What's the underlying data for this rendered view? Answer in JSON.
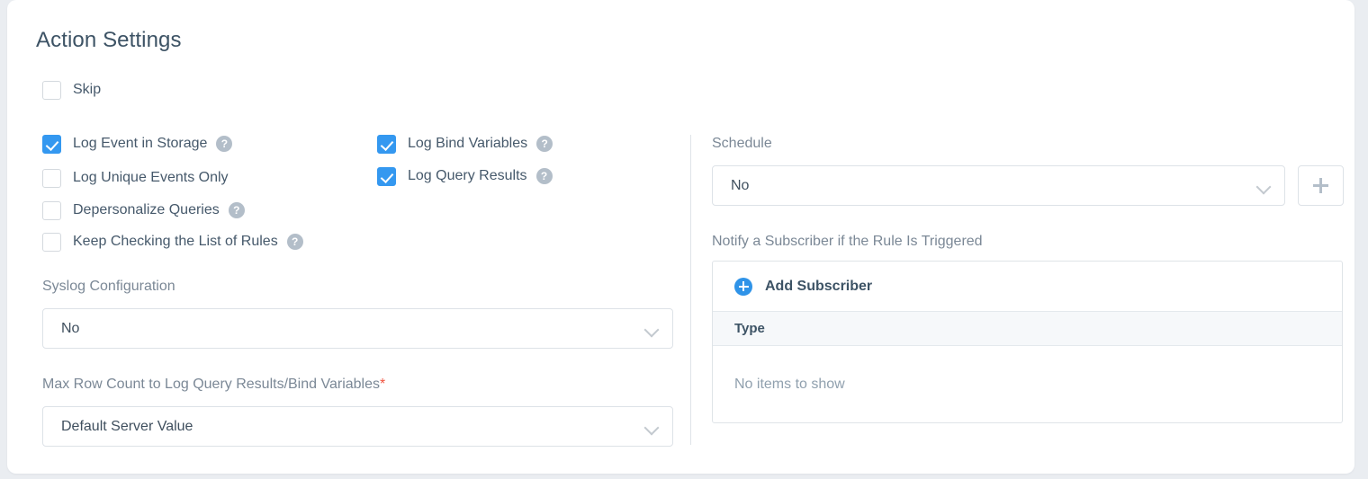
{
  "page": {
    "title": "Action Settings"
  },
  "colors": {
    "accent": "#3498f0",
    "accent_add": "#2f93e8",
    "help_icon": "#b3bec9",
    "required_marker": "#f0533f",
    "heading_text": "#3d5365",
    "label_text": "#7b8896",
    "card_background": "#ffffff",
    "page_background": "#eaedf1",
    "table_header_background": "#f6f8fa",
    "border": "#dfe4e8"
  },
  "skip": {
    "label": "Skip",
    "checked": false
  },
  "checkbox_column_left": [
    {
      "label": "Log Event in Storage",
      "checked": true,
      "help": true,
      "help_glyph": "?"
    },
    {
      "label": "Log Unique Events Only",
      "checked": false,
      "help": false,
      "help_glyph": "?"
    },
    {
      "label": "Depersonalize Queries",
      "checked": false,
      "help": true,
      "help_glyph": "?"
    },
    {
      "label": "Keep Checking the List of Rules",
      "checked": false,
      "help": true,
      "help_glyph": "?"
    }
  ],
  "checkbox_column_right": [
    {
      "label": "Log Bind Variables",
      "checked": true,
      "help": true,
      "help_glyph": "?"
    },
    {
      "label": "Log Query Results",
      "checked": true,
      "help": true,
      "help_glyph": "?"
    }
  ],
  "syslog": {
    "label": "Syslog Configuration",
    "value": "No",
    "chevron_icon": "chevron-down-icon"
  },
  "max_row_count": {
    "label": "Max Row Count to Log Query Results/Bind Variables",
    "required_marker": "*",
    "value": "Default Server Value",
    "chevron_icon": "chevron-down-icon"
  },
  "schedule": {
    "label": "Schedule",
    "value": "No",
    "chevron_icon": "chevron-down-icon",
    "add_icon": "plus-icon"
  },
  "subscribers": {
    "label": "Notify a Subscriber if the Rule Is Triggered",
    "add_label": "Add Subscriber",
    "add_icon": "circle-plus-icon",
    "columns": [
      "Type"
    ],
    "rows": [],
    "empty_text": "No items to show"
  }
}
